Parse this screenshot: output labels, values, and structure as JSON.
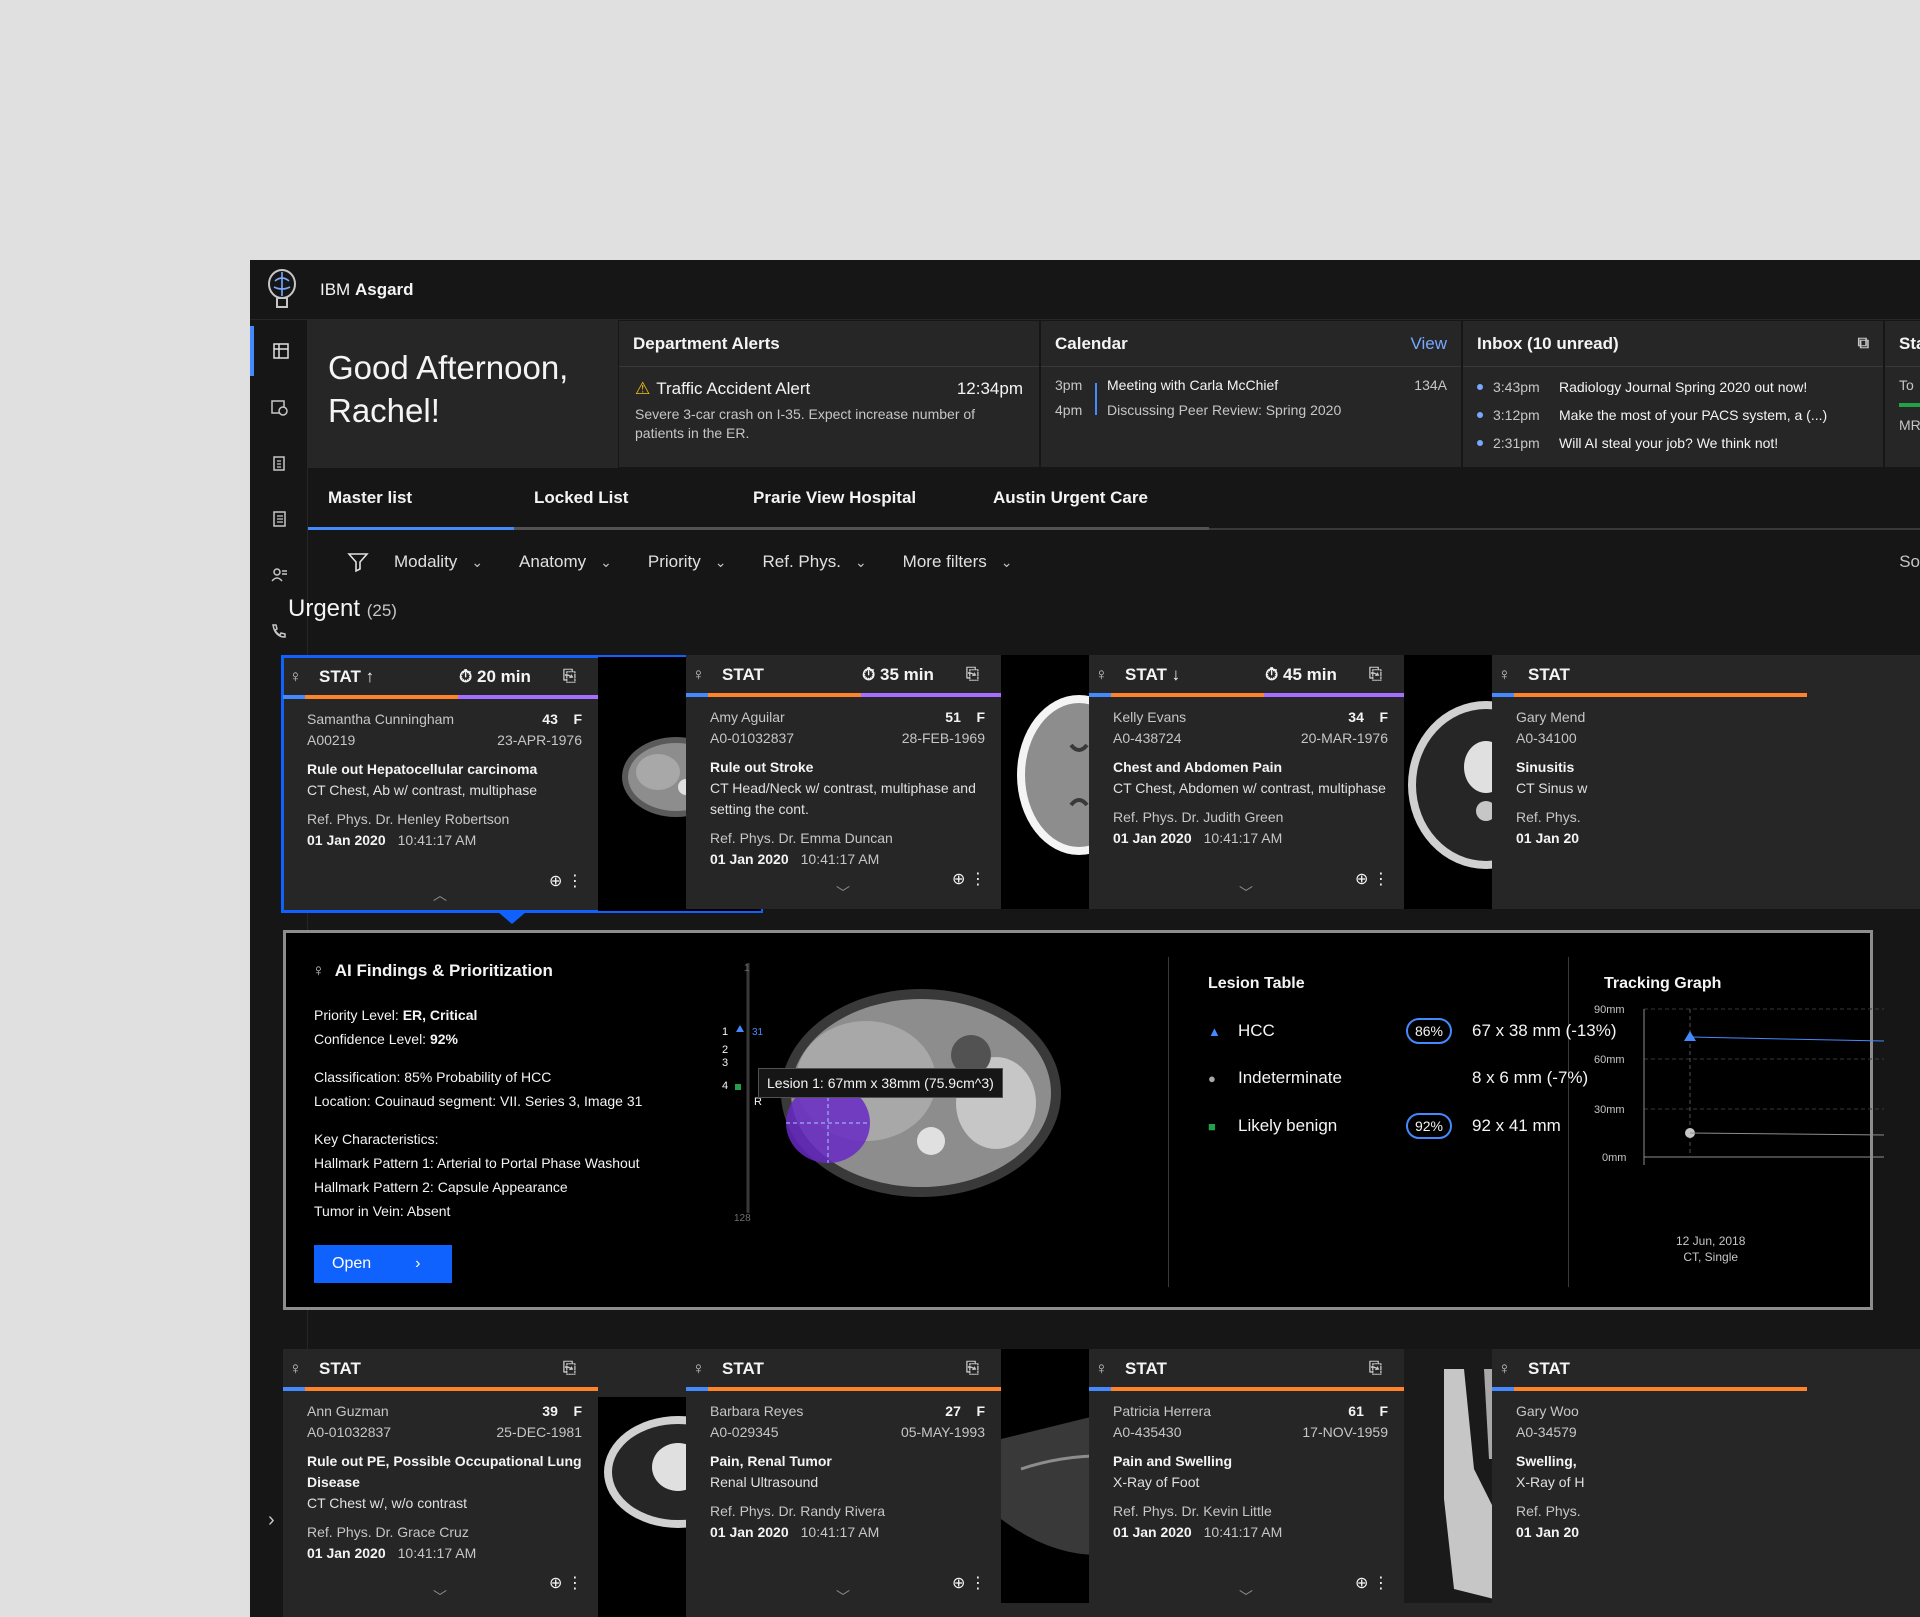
{
  "app": {
    "brand_prefix": "IBM",
    "brand_name": "Asgard"
  },
  "greeting": {
    "line1": "Good Afternoon,",
    "line2": "Rachel!"
  },
  "alerts": {
    "title": "Department Alerts",
    "name": "Traffic Accident Alert",
    "time": "12:34pm",
    "desc": "Severe 3-car crash on I-35. Expect increase number of patients in the ER."
  },
  "calendar": {
    "title": "Calendar",
    "view": "View",
    "t1": "3pm",
    "t2": "4pm",
    "e1": "Meeting with Carla McChief",
    "e2": "Discussing Peer Review: Spring 2020",
    "room": "134A"
  },
  "inbox": {
    "title": "Inbox (10 unread)",
    "items": [
      {
        "t": "3:43pm",
        "m": "Radiology Journal Spring 2020 out now!"
      },
      {
        "t": "3:12pm",
        "m": "Make the most of your PACS system, a (...)"
      },
      {
        "t": "2:31pm",
        "m": "Will AI steal your job? We think not!"
      }
    ]
  },
  "stats": {
    "title": "Sta",
    "l1": "To",
    "l2": "MR"
  },
  "tabs": [
    "Master list",
    "Locked List",
    "Prarie View Hospital",
    "Austin Urgent Care"
  ],
  "filters": [
    "Modality",
    "Anatomy",
    "Priority",
    "Ref. Phys.",
    "More filters"
  ],
  "sort": "So",
  "urgent": {
    "label": "Urgent",
    "count": "(25)"
  },
  "cards": [
    {
      "stat": "STAT ↑",
      "timer": "20 min",
      "name": "Samantha Cunningham",
      "age": "43",
      "sex": "F",
      "id": "A00219",
      "dob": "23-APR-1976",
      "reason": "Rule out Hepatocellular carcinoma",
      "study": "CT Chest, Ab w/ contrast, multiphase",
      "ref": "Ref. Phys. Dr. Henley Robertson",
      "date": "01 Jan 2020",
      "time": "10:41:17 AM"
    },
    {
      "stat": "STAT",
      "timer": "35 min",
      "name": "Amy Aguilar",
      "age": "51",
      "sex": "F",
      "id": "A0-01032837",
      "dob": "28-FEB-1969",
      "reason": "Rule out Stroke",
      "study": "CT Head/Neck w/ contrast, multiphase and setting the cont.",
      "ref": "Ref. Phys. Dr. Emma Duncan",
      "date": "01 Jan 2020",
      "time": "10:41:17 AM"
    },
    {
      "stat": "STAT ↓",
      "timer": "45 min",
      "name": "Kelly Evans",
      "age": "34",
      "sex": "F",
      "id": "A0-438724",
      "dob": "20-MAR-1976",
      "reason": "Chest and Abdomen Pain",
      "study": "CT Chest, Abdomen w/ contrast, multiphase",
      "ref": "Ref. Phys. Dr. Judith Green",
      "date": "01 Jan 2020",
      "time": "10:41:17 AM"
    },
    {
      "stat": "STAT",
      "name": "Gary Mend",
      "id": "A0-34100",
      "reason": "Sinusitis",
      "study": "CT Sinus w",
      "ref": "Ref. Phys.",
      "date": "01 Jan 20"
    },
    {
      "stat": "STAT",
      "name": "Ann Guzman",
      "age": "39",
      "sex": "F",
      "id": "A0-01032837",
      "dob": "25-DEC-1981",
      "reason": "Rule out PE, Possible Occupational Lung Disease",
      "study": "CT Chest w/, w/o contrast",
      "ref": "Ref. Phys. Dr. Grace Cruz",
      "date": "01 Jan 2020",
      "time": "10:41:17 AM"
    },
    {
      "stat": "STAT",
      "name": "Barbara Reyes",
      "age": "27",
      "sex": "F",
      "id": "A0-029345",
      "dob": "05-MAY-1993",
      "reason": "Pain, Renal Tumor",
      "study": "Renal Ultrasound",
      "ref": "Ref. Phys. Dr. Randy Rivera",
      "date": "01 Jan 2020",
      "time": "10:41:17 AM"
    },
    {
      "stat": "STAT",
      "name": "Patricia Herrera",
      "age": "61",
      "sex": "F",
      "id": "A0-435430",
      "dob": "17-NOV-1959",
      "reason": "Pain and Swelling",
      "study": "X-Ray of Foot",
      "ref": "Ref. Phys. Dr. Kevin Little",
      "date": "01 Jan 2020",
      "time": "10:41:17 AM"
    },
    {
      "stat": "STAT",
      "name": "Gary Woo",
      "id": "A0-34579",
      "reason": "Swelling,",
      "study": "X-Ray of H",
      "ref": "Ref. Phys.",
      "date": "01 Jan 20"
    }
  ],
  "detail": {
    "title": "AI Findings & Prioritization",
    "priority_label": "Priority Level:",
    "priority": "ER, Critical",
    "conf_label": "Confidence Level:",
    "conf": "92%",
    "classification": "Classification: 85% Probability of HCC",
    "location": "Location: Couinaud segment: VII. Series 3, Image 31",
    "key": "Key Characteristics:",
    "k1": "Hallmark  Pattern 1: Arterial to Portal Phase Washout",
    "k2": "Hallmark Pattern 2: Capsule Appearance",
    "k3": "Tumor in Vein: Absent",
    "open": "Open",
    "tooltip": "Lesion 1: 67mm x 38mm (75.9cm^3)",
    "slice_top": "1",
    "slice_bottom": "128",
    "slice_marker": "31",
    "r_label": "R",
    "s1": "1",
    "s2": "2",
    "s3": "3",
    "s4": "4"
  },
  "lesions": {
    "title": "Lesion Table",
    "rows": [
      {
        "name": "HCC",
        "pct": "86%",
        "size": "67 x 38 mm (-13%)"
      },
      {
        "name": "Indeterminate",
        "pct": "",
        "size": "8 x 6 mm (-7%)"
      },
      {
        "name": "Likely benign",
        "pct": "92%",
        "size": "92 x 41 mm"
      }
    ]
  },
  "tracking": {
    "title": "Tracking Graph",
    "y": [
      "90mm",
      "60mm",
      "30mm",
      "0mm"
    ],
    "date": "12 Jun, 2018",
    "desc": "CT, Single"
  },
  "colors": {
    "accent": "#0f62fe",
    "orange": "#ff832b",
    "purple": "#a56eff"
  }
}
